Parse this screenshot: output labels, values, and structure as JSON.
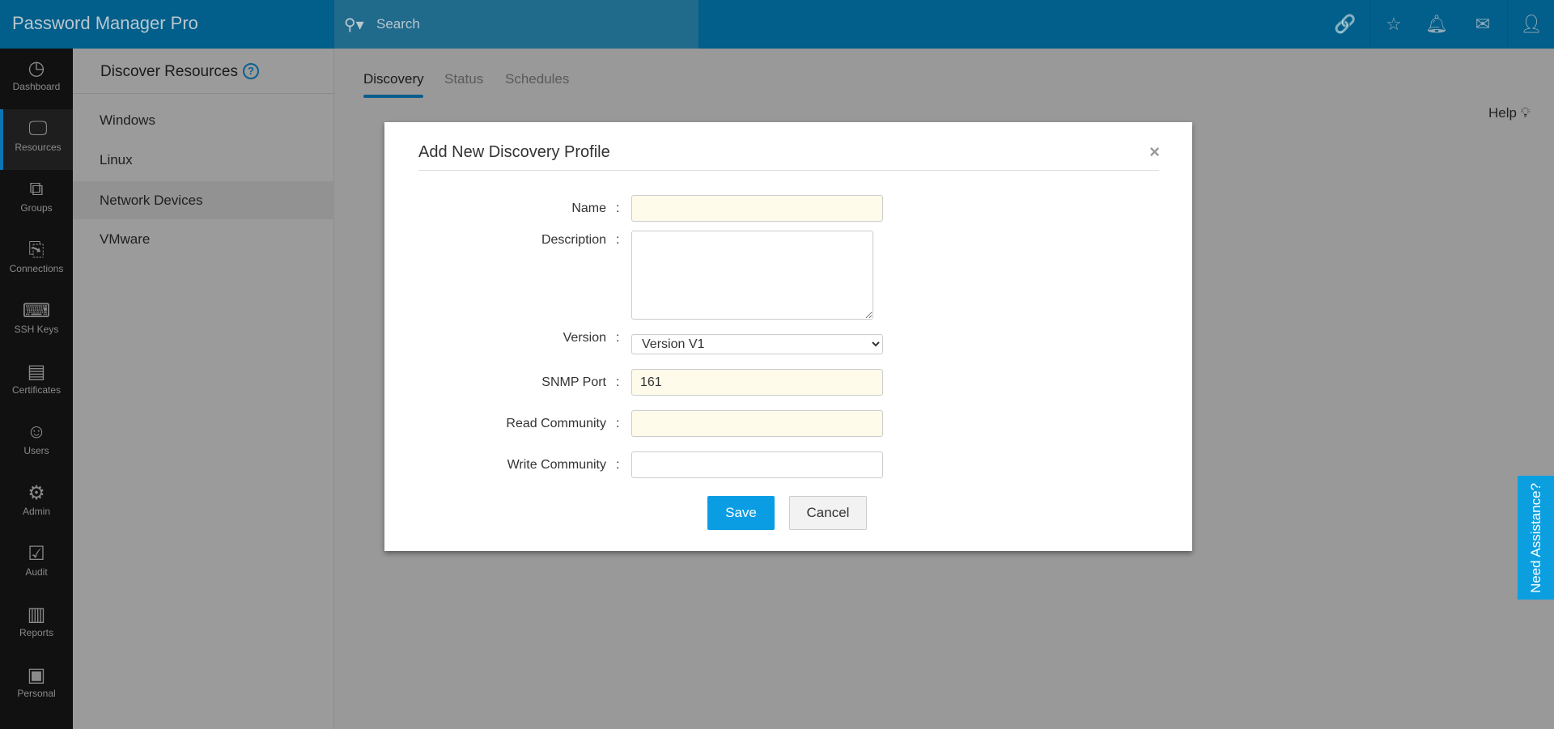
{
  "app": {
    "title": "Password Manager Pro"
  },
  "search": {
    "placeholder": "Search"
  },
  "topbar_icons": [
    "link-icon",
    "user-star-icon",
    "bell-icon",
    "mail-icon",
    "user-icon"
  ],
  "sidebar": {
    "items": [
      {
        "label": "Dashboard",
        "icon": "◷"
      },
      {
        "label": "Resources",
        "icon": "🖵",
        "active": true
      },
      {
        "label": "Groups",
        "icon": "⧉"
      },
      {
        "label": "Connections",
        "icon": "⎘"
      },
      {
        "label": "SSH Keys",
        "icon": "⌨"
      },
      {
        "label": "Certificates",
        "icon": "▤"
      },
      {
        "label": "Users",
        "icon": "☺"
      },
      {
        "label": "Admin",
        "icon": "⚙"
      },
      {
        "label": "Audit",
        "icon": "☑"
      },
      {
        "label": "Reports",
        "icon": "▥"
      },
      {
        "label": "Personal",
        "icon": "▣"
      }
    ]
  },
  "panel": {
    "title": "Discover Resources",
    "help": "?",
    "items": [
      "Windows",
      "Linux",
      "Network Devices",
      "VMware"
    ],
    "selected": "Network Devices"
  },
  "tabs": [
    "Discovery",
    "Status",
    "Schedules"
  ],
  "help": "Help",
  "assistance": "Need Assistance?",
  "modal": {
    "title": "Add New Discovery Profile",
    "close": "×",
    "colon": ":",
    "fields": {
      "name": {
        "label": "Name",
        "value": ""
      },
      "description": {
        "label": "Description",
        "value": ""
      },
      "version": {
        "label": "Version",
        "value": "Version V1"
      },
      "snmp_port": {
        "label": "SNMP Port",
        "value": "161"
      },
      "read_community": {
        "label": "Read Community",
        "value": ""
      },
      "write_community": {
        "label": "Write Community",
        "value": ""
      }
    },
    "save": "Save",
    "cancel": "Cancel"
  },
  "colors": {
    "header": "#025e8a",
    "accent": "#0a9de3",
    "assist": "#0b9fe0"
  }
}
